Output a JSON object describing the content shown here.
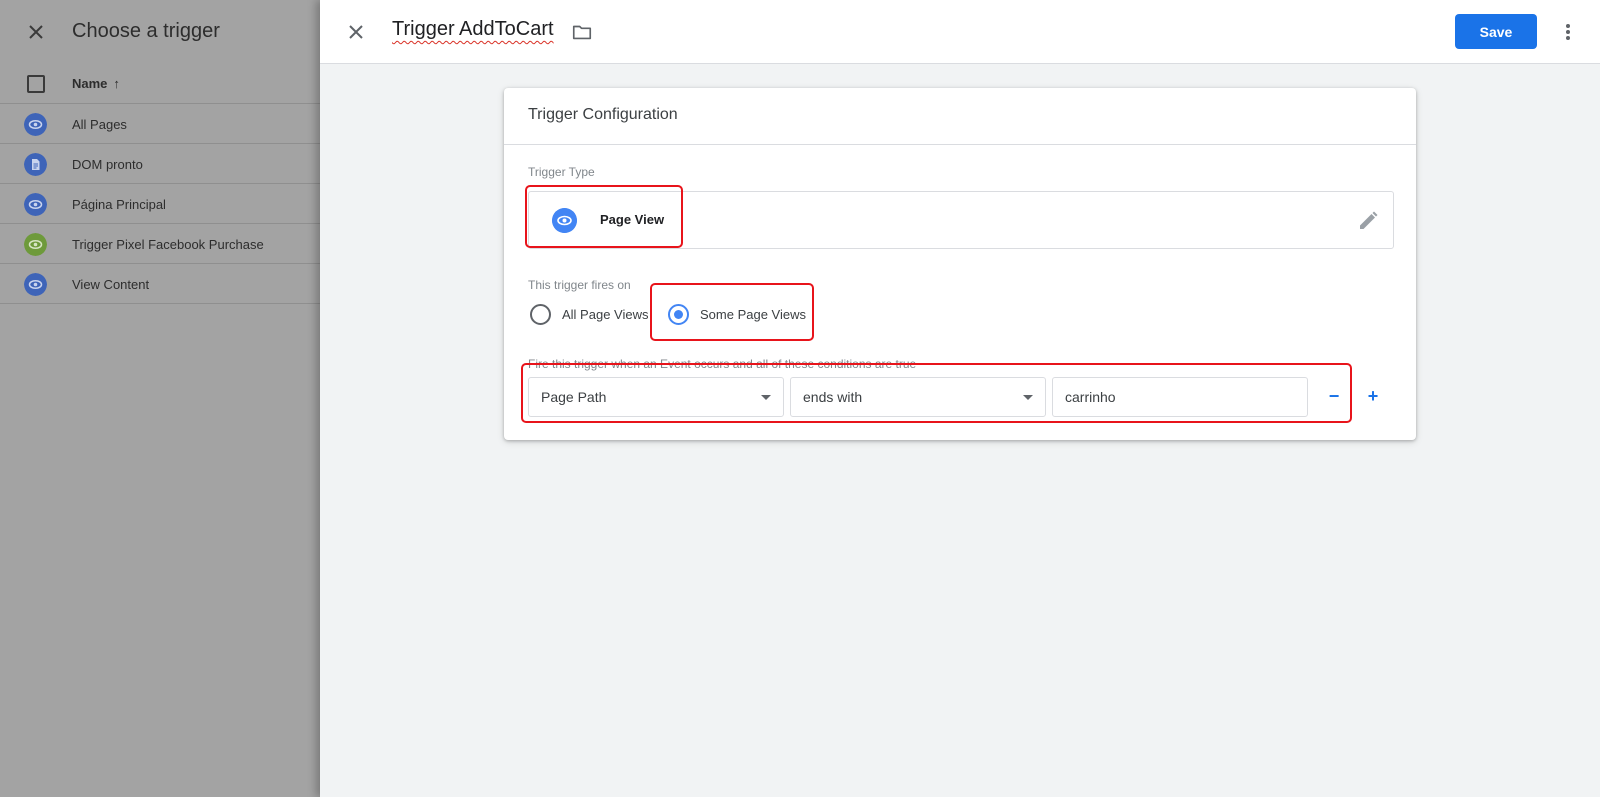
{
  "left_panel": {
    "title": "Choose a trigger",
    "column_name": "Name",
    "triggers": [
      {
        "name": "All Pages",
        "icon": "eye-icon",
        "color": "#3e64b8"
      },
      {
        "name": "DOM pronto",
        "icon": "document-icon",
        "color": "#3e64b8"
      },
      {
        "name": "Página Principal",
        "icon": "eye-icon",
        "color": "#3e64b8"
      },
      {
        "name": "Trigger Pixel Facebook Purchase",
        "icon": "eye-icon",
        "color": "#6e9a3b"
      },
      {
        "name": "View Content",
        "icon": "eye-icon",
        "color": "#3e64b8"
      }
    ]
  },
  "header": {
    "trigger_name": "Trigger AddToCart",
    "save_label": "Save"
  },
  "card": {
    "title": "Trigger Configuration",
    "trigger_type_label": "Trigger Type",
    "trigger_type": "Page View",
    "fires_on_label": "This trigger fires on",
    "fires_on_options": [
      "All Page Views",
      "Some Page Views"
    ],
    "fires_on_selected": "Some Page Views",
    "conditions_label": "Fire this trigger when an Event occurs and all of these conditions are true",
    "condition": {
      "variable": "Page Path",
      "operator": "ends with",
      "value": "carrinho",
      "remove_label": "−",
      "add_label": "+"
    }
  },
  "colors": {
    "accent": "#1a73e8",
    "annotation": "#e8141b"
  }
}
